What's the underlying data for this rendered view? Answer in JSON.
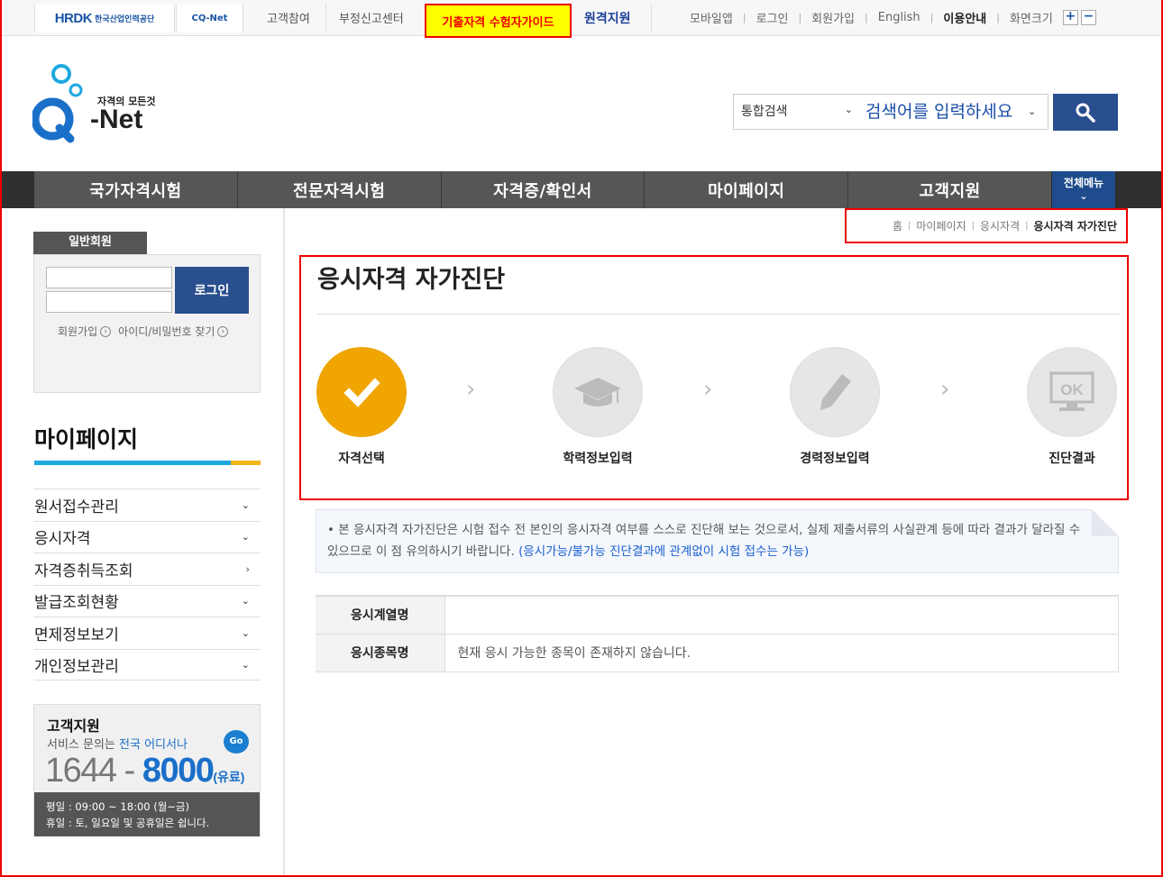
{
  "top_bar": {
    "hrdk_logo": "HRDK",
    "hrdk_name": "한국산업인력공단",
    "cqnet_logo": "CQ",
    "cqnet_suffix": "-Net",
    "links_left": [
      "고객참여",
      "부정신고센터"
    ],
    "guide_link": "기출자격 수험자가이드",
    "remote_link": "원격지원",
    "links_right": [
      "모바일앱",
      "로그인",
      "회원가입",
      "English",
      "이용안내",
      "화면크기"
    ],
    "zoom_in": "+",
    "zoom_out": "−"
  },
  "brand": {
    "tagline": "자격의 모든것",
    "name": "Net",
    "letter": "Q"
  },
  "search": {
    "scope": "통합검색",
    "placeholder": "검색어를 입력하세요"
  },
  "gnb": {
    "items": [
      "국가자격시험",
      "전문자격시험",
      "자격증/확인서",
      "마이페이지",
      "고객지원"
    ],
    "all_menu": "전체메뉴"
  },
  "sidebar": {
    "member_tab": "일반회원",
    "login_button": "로그인",
    "signup_link": "회원가입",
    "find_link": "아이디/비밀번호 찾기",
    "section_title": "마이페이지",
    "menu": [
      {
        "label": "원서접수관리",
        "arrow": "⌄"
      },
      {
        "label": "응시자격",
        "arrow": "⌄"
      },
      {
        "label": "자격증취득조회",
        "arrow": "›"
      },
      {
        "label": "발급조회현황",
        "arrow": "⌄"
      },
      {
        "label": "면제정보보기",
        "arrow": "⌄"
      },
      {
        "label": "개인정보관리",
        "arrow": "⌄"
      }
    ],
    "support": {
      "title": "고객지원",
      "sub_prefix": "서비스 문의는 ",
      "sub_highlight": "전국 어디서나",
      "go": "Go",
      "phone_a": "1644",
      "phone_dash": "-",
      "phone_b": "8000",
      "fee": "(유료)",
      "hours_weekday": "평일 : 09:00 ~ 18:00 (월~금)",
      "hours_holiday": "휴일 : 토, 일요일 및 공휴일은 쉽니다."
    }
  },
  "breadcrumb": [
    "홈",
    "마이페이지",
    "응시자격",
    "응시자격 자가진단"
  ],
  "main": {
    "title": "응시자격 자가진단",
    "steps": [
      {
        "label": "자격선택",
        "icon": "check-icon",
        "active": true
      },
      {
        "label": "학력정보입력",
        "icon": "graduation-cap-icon",
        "active": false
      },
      {
        "label": "경력정보입력",
        "icon": "pencil-icon",
        "active": false
      },
      {
        "label": "진단결과",
        "icon": "ok-monitor-icon",
        "active": false
      }
    ],
    "notice_text": "본 응시자격 자가진단은 시험 접수 전 본인의 응시자격 여부를 스스로 진단해 보는 것으로서, 실제 제출서류의 사실관계 등에 따라 결과가 달라질 수 있으므로 이 점 유의하시기 바랍니다.",
    "notice_highlight": "(응시가능/불가능 진단결과에 관계없이 시험 접수는 가능)",
    "table": [
      {
        "label": "응시계열명",
        "value": ""
      },
      {
        "label": "응시종목명",
        "value": "현재 응시 가능한 종목이 존재하지 않습니다."
      }
    ]
  },
  "colors": {
    "accent_blue": "#2a4f8f",
    "active_step": "#f0a500",
    "highlight_red": "#ee0000",
    "guide_yellow": "#ffff00"
  }
}
